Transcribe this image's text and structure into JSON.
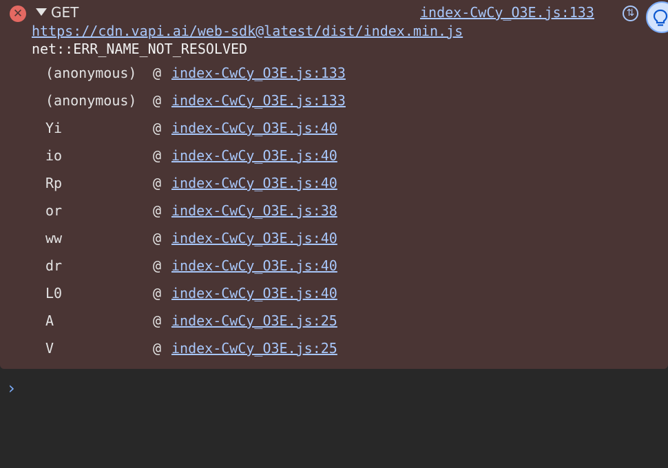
{
  "message": {
    "method": "GET",
    "source": "index-CwCy_O3E.js:133",
    "url": "https://cdn.vapi.ai/web-sdk@latest/dist/index.min.js",
    "error": "net::ERR_NAME_NOT_RESOLVED",
    "icons": {
      "error": "error-circle-icon",
      "expand": "disclosure-triangle-icon",
      "network": "network-request-icon",
      "insight": "lightbulb-icon"
    }
  },
  "stack": [
    {
      "fn": "(anonymous)",
      "at": "@",
      "link": "index-CwCy_O3E.js:133"
    },
    {
      "fn": "(anonymous)",
      "at": "@",
      "link": "index-CwCy_O3E.js:133"
    },
    {
      "fn": "Yi",
      "at": "@",
      "link": "index-CwCy_O3E.js:40"
    },
    {
      "fn": "io",
      "at": "@",
      "link": "index-CwCy_O3E.js:40"
    },
    {
      "fn": "Rp",
      "at": "@",
      "link": "index-CwCy_O3E.js:40"
    },
    {
      "fn": "or",
      "at": "@",
      "link": "index-CwCy_O3E.js:38"
    },
    {
      "fn": "ww",
      "at": "@",
      "link": "index-CwCy_O3E.js:40"
    },
    {
      "fn": "dr",
      "at": "@",
      "link": "index-CwCy_O3E.js:40"
    },
    {
      "fn": "L0",
      "at": "@",
      "link": "index-CwCy_O3E.js:40"
    },
    {
      "fn": "A",
      "at": "@",
      "link": "index-CwCy_O3E.js:25"
    },
    {
      "fn": "V",
      "at": "@",
      "link": "index-CwCy_O3E.js:25"
    }
  ],
  "prompt": {
    "symbol": "›"
  },
  "colors": {
    "error_bg": "#4a3534",
    "console_bg": "#282828",
    "link": "#a8c7fa",
    "error_icon": "#e46962"
  }
}
